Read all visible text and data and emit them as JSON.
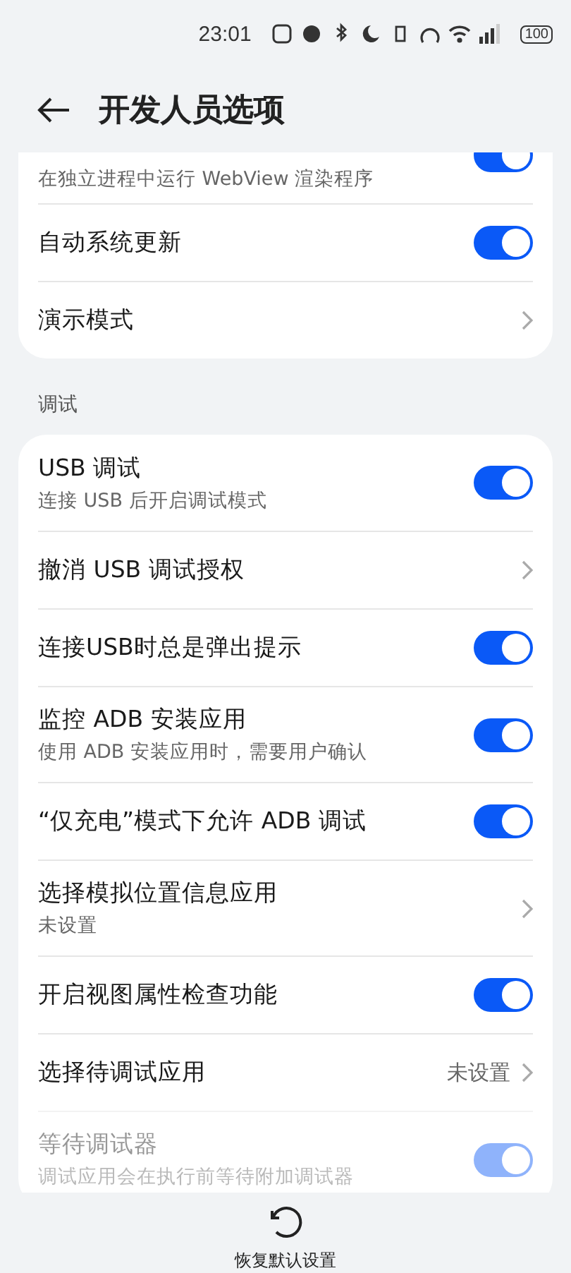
{
  "status_bar": {
    "time": "23:01",
    "battery": "100"
  },
  "header": {
    "title": "开发人员选项"
  },
  "groups": [
    {
      "rows": [
        {
          "kind": "toggle",
          "subtitle": "在独立进程中运行 WebView 渲染程序",
          "on": true,
          "disabled": false,
          "cut": true
        },
        {
          "kind": "toggle",
          "title": "自动系统更新",
          "on": true,
          "disabled": false
        },
        {
          "kind": "link",
          "title": "演示模式",
          "disabled": false
        }
      ]
    },
    {
      "label": "调试",
      "rows": [
        {
          "kind": "toggle",
          "title": "USB 调试",
          "subtitle": "连接 USB 后开启调试模式",
          "on": true,
          "disabled": false
        },
        {
          "kind": "link",
          "title": "撤消 USB 调试授权",
          "disabled": false
        },
        {
          "kind": "toggle",
          "title": "连接USB时总是弹出提示",
          "on": true,
          "disabled": false
        },
        {
          "kind": "toggle",
          "title": "监控 ADB 安装应用",
          "subtitle": "使用 ADB 安装应用时，需要用户确认",
          "on": true,
          "disabled": false
        },
        {
          "kind": "toggle",
          "title": "“仅充电”模式下允许 ADB 调试",
          "on": true,
          "disabled": false
        },
        {
          "kind": "link",
          "title": "选择模拟位置信息应用",
          "subtitle": "未设置",
          "disabled": false
        },
        {
          "kind": "toggle",
          "title": "开启视图属性检查功能",
          "on": true,
          "disabled": false
        },
        {
          "kind": "link",
          "title": "选择待调试应用",
          "value": "未设置",
          "disabled": false
        },
        {
          "kind": "toggle",
          "title": "等待调试器",
          "subtitle": "调试应用会在执行前等待附加调试器",
          "on": true,
          "disabled": true
        }
      ]
    }
  ],
  "footer": {
    "label": "恢复默认设置"
  }
}
